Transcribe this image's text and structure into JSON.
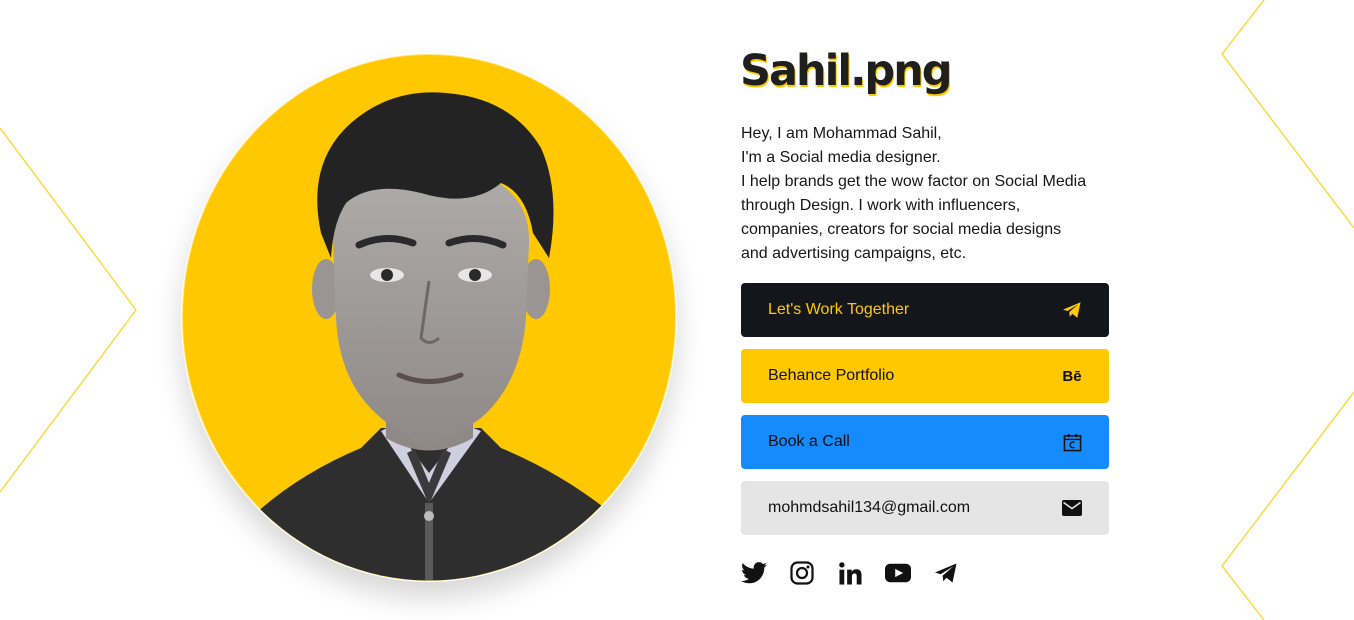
{
  "title": "Sahil.png",
  "bio": {
    "line1": "Hey, I am Mohammad Sahil,",
    "line2": "I'm a Social media designer.",
    "line3": "I help brands get the wow factor on Social Media",
    "line4": "through Design. I work with influencers,",
    "line5": "companies, creators for social media designs",
    "line6": "and advertising campaigns, etc."
  },
  "buttons": {
    "work": {
      "label": "Let's Work Together",
      "icon": "telegram-send-icon"
    },
    "behance": {
      "label": "Behance Portfolio",
      "icon_text": "Bē"
    },
    "call": {
      "label": "Book a Call",
      "icon": "calendar-icon"
    },
    "email": {
      "label": "mohmdsahil134@gmail.com",
      "icon": "envelope-icon"
    }
  },
  "socials": [
    "twitter-icon",
    "instagram-icon",
    "linkedin-icon",
    "youtube-icon",
    "telegram-icon"
  ],
  "colors": {
    "accent_yellow": "#ffc800",
    "dark": "#15161b",
    "blue": "#168bff",
    "light_gray": "#e5e5e5"
  }
}
